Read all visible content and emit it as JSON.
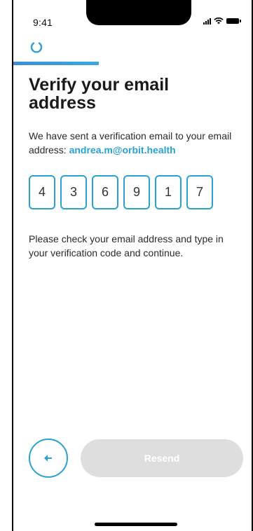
{
  "status_bar": {
    "time": "9:41"
  },
  "header": {
    "progress": 0.36
  },
  "verify": {
    "title": "Verify your email address",
    "description": "We have sent a verification email to your email address:",
    "email": "andrea.m@orbit.health",
    "code_digits": [
      "4",
      "3",
      "6",
      "9",
      "1",
      "7"
    ],
    "hint": "Please check your email address and type in your verification code and continue."
  },
  "footer": {
    "resend_label": "Resend"
  },
  "colors": {
    "accent": "#2aa2cf",
    "progress": "#3b8fd6",
    "disabled_button": "#dedede"
  },
  "icons": {
    "loader": "loader-icon",
    "back": "arrow-left-icon"
  }
}
